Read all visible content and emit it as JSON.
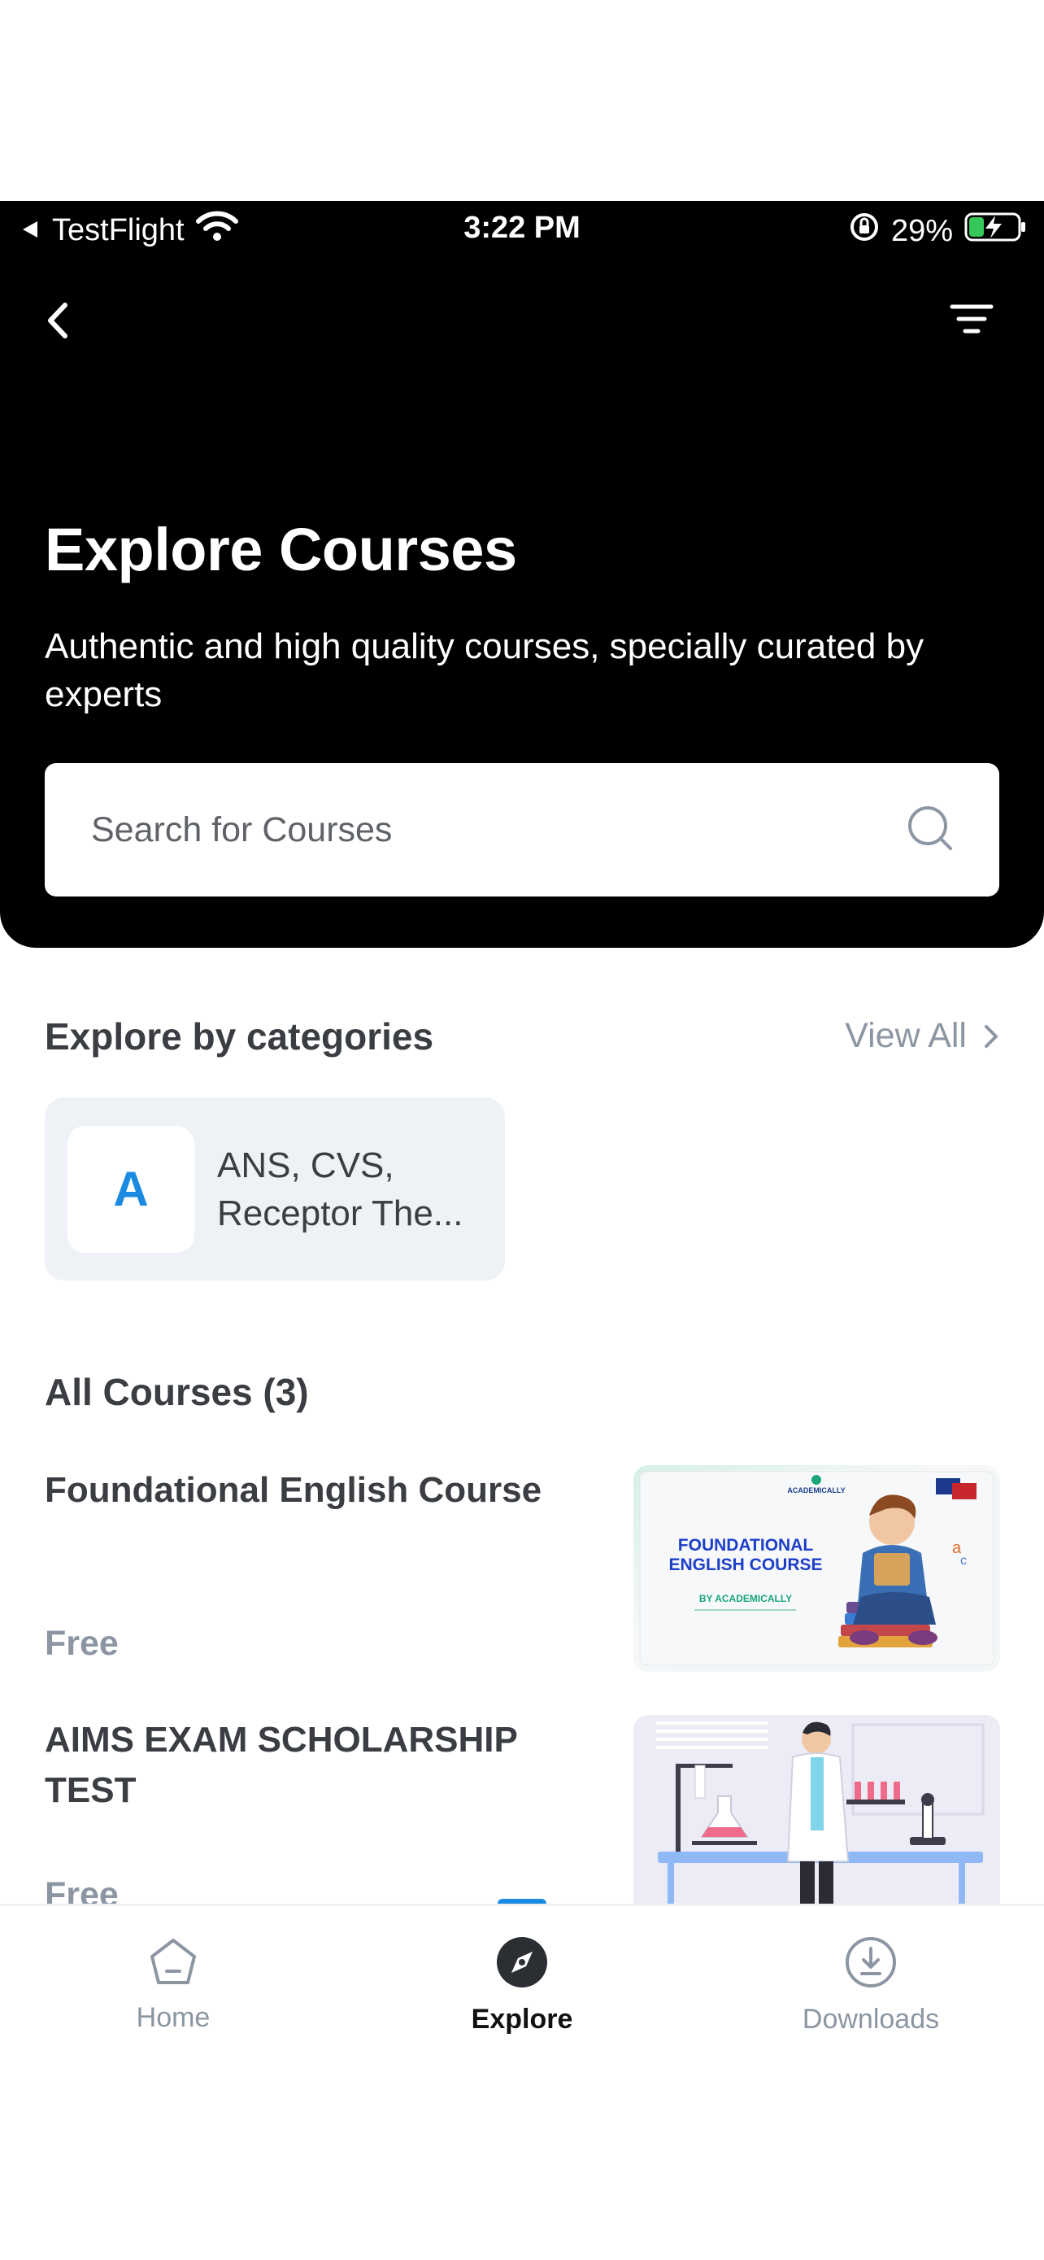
{
  "status_bar": {
    "carrier": "TestFlight",
    "time": "3:22 PM",
    "battery": "29%"
  },
  "header": {
    "title": "Explore Courses",
    "subtitle": "Authentic and high quality courses, specially curated by experts"
  },
  "search": {
    "placeholder": "Search for Courses",
    "value": ""
  },
  "categories": {
    "heading": "Explore by categories",
    "view_all": "View All",
    "items": [
      {
        "initial": "A",
        "label": "ANS, CVS, Receptor The..."
      }
    ]
  },
  "courses": {
    "heading": "All Courses (3)",
    "items": [
      {
        "title": "Foundational English Course",
        "price": "Free",
        "thumb_title_line1": "FOUNDATIONAL",
        "thumb_title_line2": "ENGLISH COURSE",
        "thumb_byline": "BY ACADEMICALLY",
        "thumb_brand": "ACADEMICALLY"
      },
      {
        "title": "AIMS EXAM SCHOLARSHIP TEST",
        "price": "Free"
      }
    ]
  },
  "tab_bar": {
    "tabs": [
      {
        "label": "Home",
        "icon": "home-icon",
        "active": false
      },
      {
        "label": "Explore",
        "icon": "compass-icon",
        "active": true
      },
      {
        "label": "Downloads",
        "icon": "download-icon",
        "active": false
      }
    ]
  },
  "colors": {
    "header_bg": "#000000",
    "accent": "#1a8be0",
    "muted_text": "#8c96a3",
    "card_bg": "#eef2f7"
  }
}
